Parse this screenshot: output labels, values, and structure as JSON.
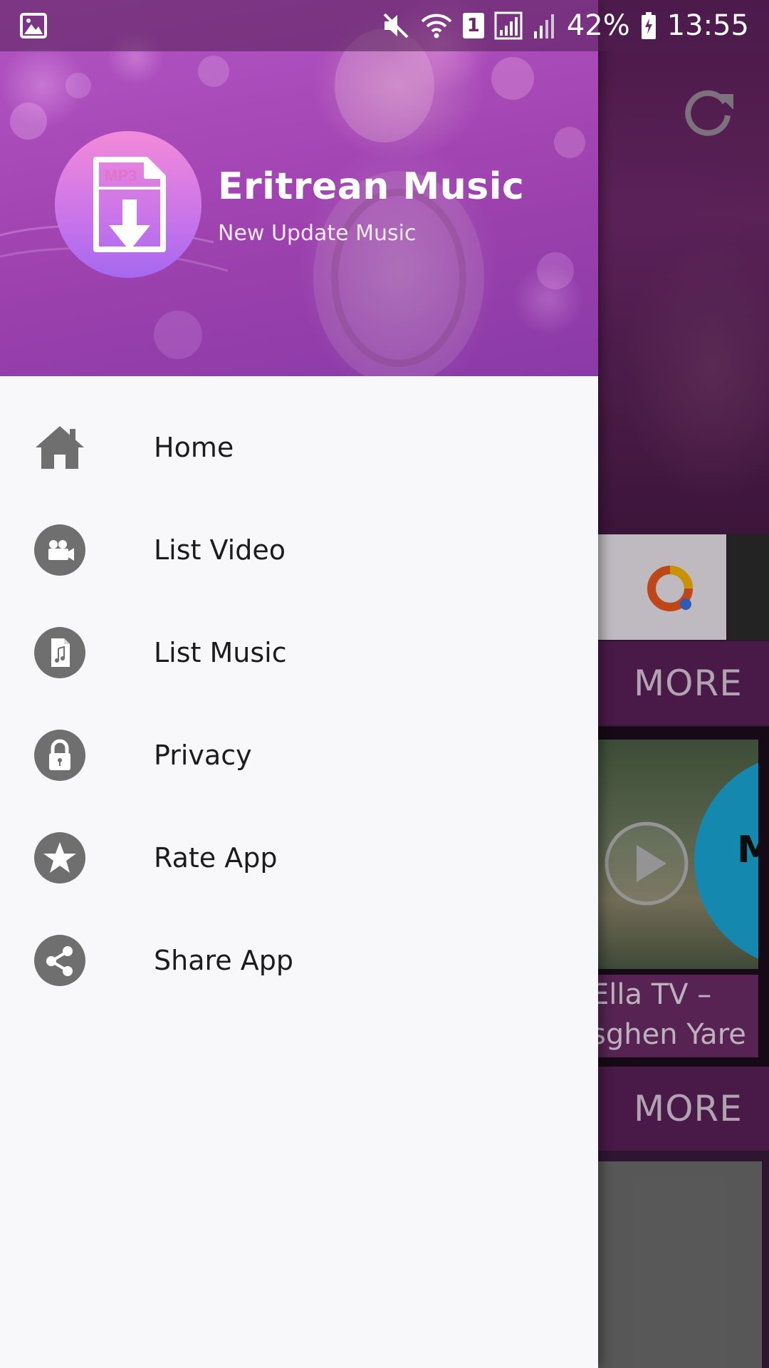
{
  "status_bar": {
    "battery": "42%",
    "time": "13:55",
    "sim_slot": "1",
    "icons": [
      "image-notification-icon",
      "mute-icon",
      "wifi-icon",
      "sim-icon",
      "signal-icon",
      "signal-weak-icon",
      "battery-charging-icon"
    ]
  },
  "drawer": {
    "header": {
      "app_title": "Eritrean Music",
      "app_subtitle": "New Update Music",
      "logo_text": "MP3",
      "logo_icon": "mp3-download-icon"
    },
    "menu": [
      {
        "label": "Home",
        "icon": "home-icon"
      },
      {
        "label": "List Video",
        "icon": "video-camera-icon"
      },
      {
        "label": "List Music",
        "icon": "music-file-icon"
      },
      {
        "label": "Privacy",
        "icon": "lock-icon"
      },
      {
        "label": "Rate App",
        "icon": "star-icon"
      },
      {
        "label": "Share App",
        "icon": "share-icon"
      }
    ]
  },
  "background": {
    "more_label_1": "MORE",
    "more_label_2": "MORE",
    "video_title_line1": "Ella TV –",
    "video_title_line2": "sghen Yare",
    "thumb_letter": "M",
    "refresh_icon": "refresh-icon",
    "play_icon": "play-icon"
  },
  "colors": {
    "drawer_bg": "#f8f7fa",
    "header_purple": "#a849b8",
    "icon_gray": "#6f6f6f",
    "app_bg": "#5a1f57"
  }
}
